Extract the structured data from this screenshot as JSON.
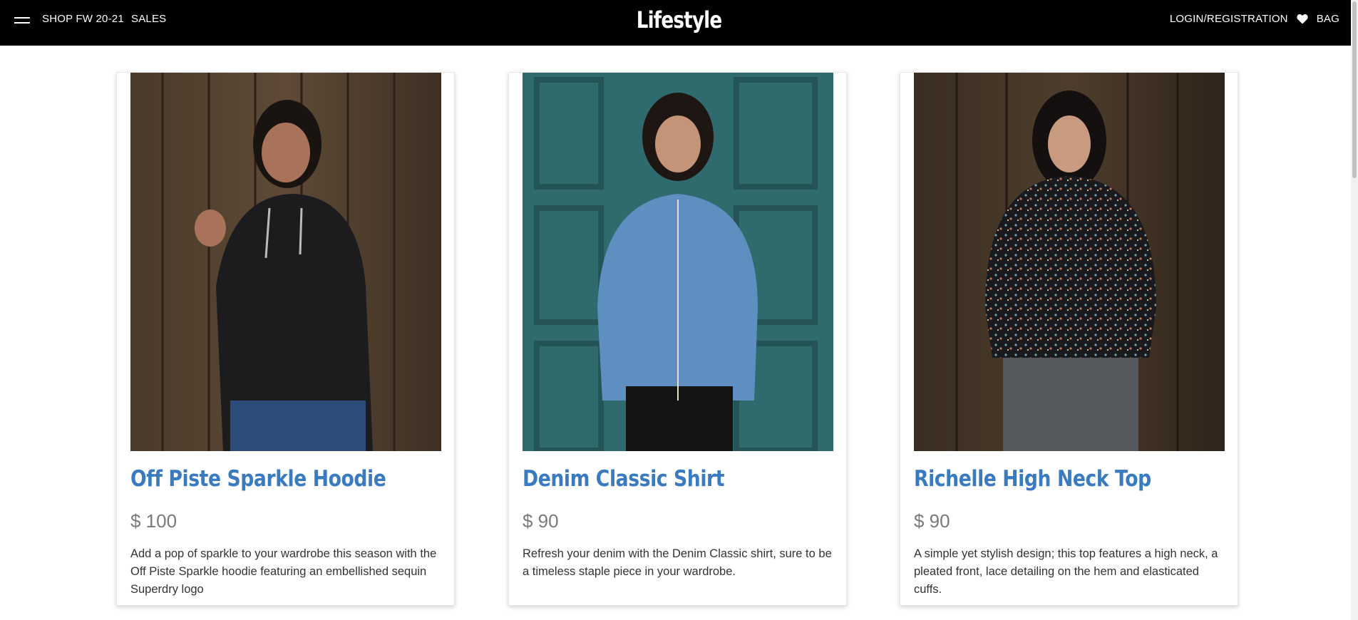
{
  "header": {
    "nav_left": [
      "SHOP FW 20-21",
      "SALES"
    ],
    "brand": "Lifestyle",
    "login_label": "LOGIN/REGISTRATION",
    "bag_label": "BAG"
  },
  "colors": {
    "header_bg": "#000000",
    "title_blue": "#3a7bbf",
    "price_gray": "#7a7a7a"
  },
  "products": [
    {
      "title": "Off Piste Sparkle Hoodie",
      "price": "$ 100",
      "description": "Add a pop of sparkle to your wardrobe this season with the Off Piste Sparkle hoodie featuring an embellished sequin Superdry logo"
    },
    {
      "title": "Denim Classic Shirt",
      "price": "$ 90",
      "description": "Refresh your denim with the Denim Classic shirt, sure to be a timeless staple piece in your wardrobe."
    },
    {
      "title": "Richelle High Neck Top",
      "price": "$ 90",
      "description": "A simple yet stylish design; this top features a high neck, a pleated front, lace detailing on the hem and elasticated cuffs."
    }
  ]
}
